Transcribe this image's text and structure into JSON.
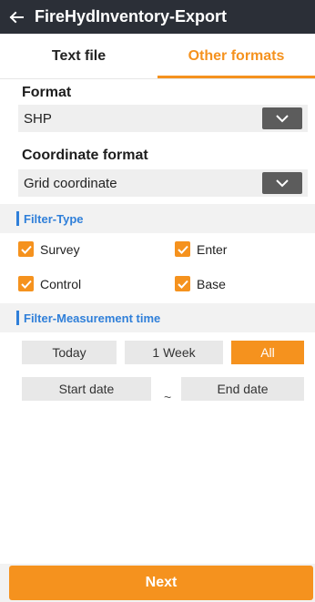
{
  "app_bar": {
    "title": "FireHydInventory-Export"
  },
  "tabs": [
    {
      "label": "Text file",
      "active": false
    },
    {
      "label": "Other formats",
      "active": true
    }
  ],
  "format": {
    "label": "Format",
    "value": "SHP"
  },
  "coordinate_format": {
    "label": "Coordinate format",
    "value": "Grid coordinate"
  },
  "filter_type": {
    "title": "Filter-Type",
    "options": [
      {
        "label": "Survey",
        "checked": true
      },
      {
        "label": "Enter",
        "checked": true
      },
      {
        "label": "Control",
        "checked": true
      },
      {
        "label": "Base",
        "checked": true
      }
    ]
  },
  "filter_time": {
    "title": "Filter-Measurement time",
    "ranges": [
      {
        "label": "Today",
        "selected": false
      },
      {
        "label": "1 Week",
        "selected": false
      },
      {
        "label": "All",
        "selected": true
      }
    ],
    "start_date": "Start date",
    "separator": "~",
    "end_date": "End date"
  },
  "next_button": {
    "label": "Next"
  },
  "colors": {
    "accent": "#f5921e",
    "app_bar": "#2b2f37",
    "section_title": "#2f7fd9"
  }
}
